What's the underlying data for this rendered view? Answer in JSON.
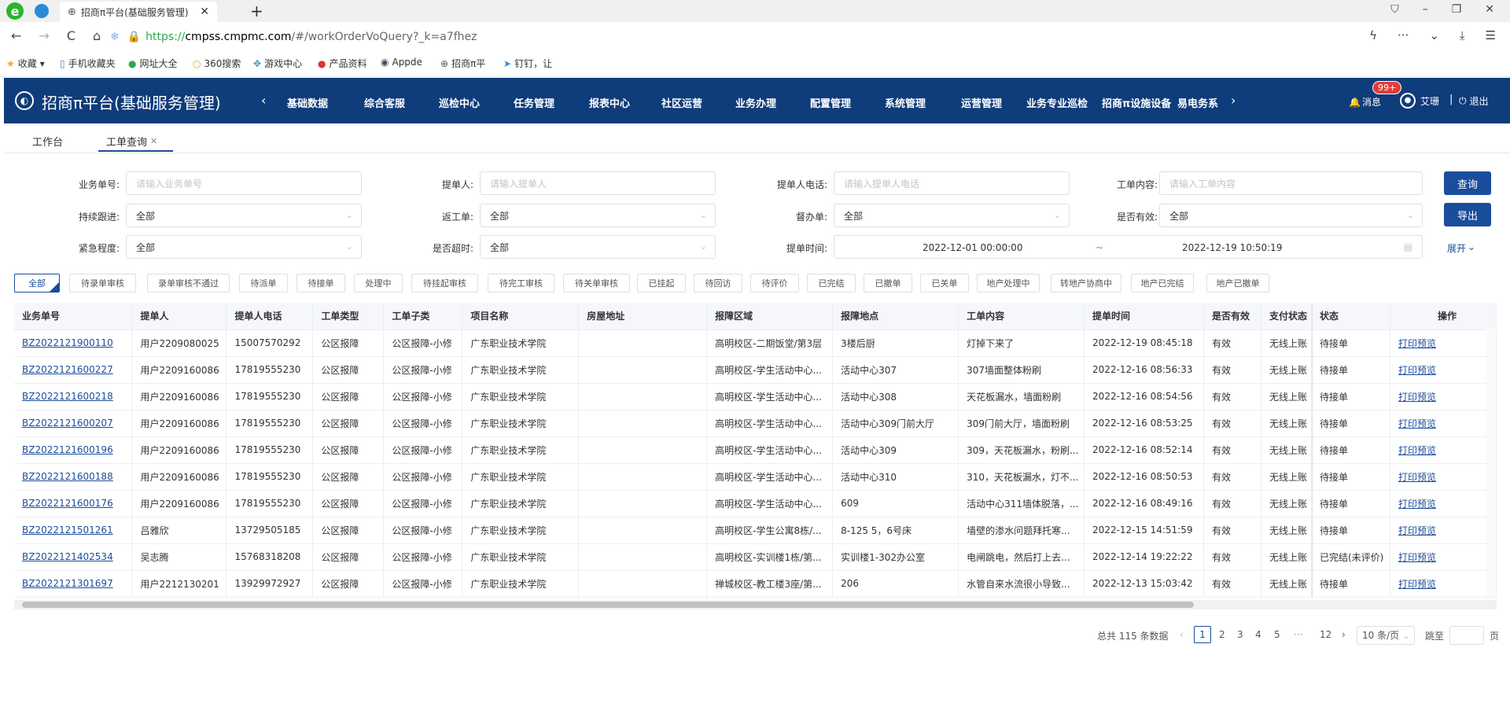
{
  "browser": {
    "tab_title": "招商π平台(基础服务管理)",
    "url_prefix": "https://",
    "url_domain": "cmpss.cmpmc.com",
    "url_rest": "/#/workOrderVoQuery?_k=a7fhez",
    "bookmarks": [
      "收藏",
      "手机收藏夹",
      "网址大全",
      "360搜索",
      "游戏中心",
      "产品资料",
      "Appde",
      "招商π平",
      "钉钉，让"
    ]
  },
  "app": {
    "title": "招商π平台(基础服务管理)",
    "nav": [
      "基础数据",
      "综合客服",
      "巡检中心",
      "任务管理",
      "报表中心",
      "社区运营",
      "业务办理",
      "配置管理",
      "系统管理",
      "运营管理",
      "业务专业巡检",
      "招商π设施设备",
      "易电务系"
    ],
    "badge": "99+",
    "msg_label": "消息",
    "user": "艾珊",
    "logout": "退出",
    "accent": "#0f3c7a"
  },
  "page_tabs": {
    "home": "工作台",
    "current": "工单查询"
  },
  "filters": {
    "biz_no_label": "业务单号:",
    "biz_no_ph": "请输入业务单号",
    "submitter_label": "提单人:",
    "submitter_ph": "请输入提单人",
    "phone_label": "提单人电话:",
    "phone_ph": "请输入提单人电话",
    "content_label": "工单内容:",
    "content_ph": "请输入工单内容",
    "follow_label": "持续跟进:",
    "follow_val": "全部",
    "return_label": "返工单:",
    "return_val": "全部",
    "supervise_label": "督办单:",
    "supervise_val": "全部",
    "valid_label": "是否有效:",
    "valid_val": "全部",
    "urgency_label": "紧急程度:",
    "urgency_val": "全部",
    "timeout_label": "是否超时:",
    "timeout_val": "全部",
    "time_label": "提单时间:",
    "time_start": "2022-12-01 00:00:00",
    "time_sep": "~",
    "time_end": "2022-12-19 10:50:19",
    "query_btn": "查询",
    "export_btn": "导出",
    "expand": "展开"
  },
  "chips": [
    "全部",
    "待录单审核",
    "录单审核不通过",
    "待派单",
    "待接单",
    "处理中",
    "待挂起审核",
    "待完工审核",
    "待关单审核",
    "已挂起",
    "待回访",
    "待评价",
    "已完结",
    "已撤单",
    "已关单",
    "地产处理中",
    "转地产协商中",
    "地产已完结",
    "地产已撤单"
  ],
  "table": {
    "columns": [
      "业务单号",
      "提单人",
      "提单人电话",
      "工单类型",
      "工单子类",
      "项目名称",
      "房屋地址",
      "报障区域",
      "报障地点",
      "工单内容",
      "提单时间",
      "是否有效",
      "支付状态",
      "状态",
      "操作"
    ],
    "rows": [
      [
        "BZ2022121900110",
        "用户2209080025",
        "15007570292",
        "公区报障",
        "公区报障-小修",
        "广东职业技术学院",
        "",
        "高明校区-二期饭堂/第3层",
        "3楼后厨",
        "灯掉下来了",
        "2022-12-19 08:45:18",
        "有效",
        "无线上账",
        "待接单",
        "打印预览"
      ],
      [
        "BZ2022121600227",
        "用户2209160086",
        "17819555230",
        "公区报障",
        "公区报障-小修",
        "广东职业技术学院",
        "",
        "高明校区-学生活动中心...",
        "活动中心307",
        "307墙面整体粉刷",
        "2022-12-16 08:56:33",
        "有效",
        "无线上账",
        "待接单",
        "打印预览"
      ],
      [
        "BZ2022121600218",
        "用户2209160086",
        "17819555230",
        "公区报障",
        "公区报障-小修",
        "广东职业技术学院",
        "",
        "高明校区-学生活动中心...",
        "活动中心308",
        "天花板漏水，墙面粉刷",
        "2022-12-16 08:54:56",
        "有效",
        "无线上账",
        "待接单",
        "打印预览"
      ],
      [
        "BZ2022121600207",
        "用户2209160086",
        "17819555230",
        "公区报障",
        "公区报障-小修",
        "广东职业技术学院",
        "",
        "高明校区-学生活动中心...",
        "活动中心309门前大厅",
        "309门前大厅，墙面粉刷",
        "2022-12-16 08:53:25",
        "有效",
        "无线上账",
        "待接单",
        "打印预览"
      ],
      [
        "BZ2022121600196",
        "用户2209160086",
        "17819555230",
        "公区报障",
        "公区报障-小修",
        "广东职业技术学院",
        "",
        "高明校区-学生活动中心...",
        "活动中心309",
        "309，天花板漏水，粉刷...",
        "2022-12-16 08:52:14",
        "有效",
        "无线上账",
        "待接单",
        "打印预览"
      ],
      [
        "BZ2022121600188",
        "用户2209160086",
        "17819555230",
        "公区报障",
        "公区报障-小修",
        "广东职业技术学院",
        "",
        "高明校区-学生活动中心...",
        "活动中心310",
        "310，天花板漏水，灯不...",
        "2022-12-16 08:50:53",
        "有效",
        "无线上账",
        "待接单",
        "打印预览"
      ],
      [
        "BZ2022121600176",
        "用户2209160086",
        "17819555230",
        "公区报障",
        "公区报障-小修",
        "广东职业技术学院",
        "",
        "高明校区-学生活动中心...",
        "609",
        "活动中心311墙体脱落，...",
        "2022-12-16 08:49:16",
        "有效",
        "无线上账",
        "待接单",
        "打印预览"
      ],
      [
        "BZ2022121501261",
        "吕雅欣",
        "13729505185",
        "公区报障",
        "公区报障-小修",
        "广东职业技术学院",
        "",
        "高明校区-学生公寓8栋/...",
        "8-125 5，6号床",
        "墙壁的渗水问题拜托寒...",
        "2022-12-15 14:51:59",
        "有效",
        "无线上账",
        "待接单",
        "打印预览"
      ],
      [
        "BZ2022121402534",
        "吴志腾",
        "15768318208",
        "公区报障",
        "公区报障-小修",
        "广东职业技术学院",
        "",
        "高明校区-实训楼1栋/第...",
        "实训楼1-302办公室",
        "电闸跳电，然后打上去...",
        "2022-12-14 19:22:22",
        "有效",
        "无线上账",
        "已完结(未评价)",
        "打印预览"
      ],
      [
        "BZ2022121301697",
        "用户2212130201",
        "13929972927",
        "公区报障",
        "公区报障-小修",
        "广东职业技术学院",
        "",
        "禅城校区-教工楼3座/第...",
        "206",
        "水管自来水流很小导致...",
        "2022-12-13 15:03:42",
        "有效",
        "无线上账",
        "待接单",
        "打印预览"
      ]
    ]
  },
  "pagination": {
    "total": "总共 115 条数据",
    "pages": [
      "1",
      "2",
      "3",
      "4",
      "5",
      "···",
      "12"
    ],
    "page_size": "10 条/页",
    "goto": "跳至",
    "page_unit": "页"
  }
}
